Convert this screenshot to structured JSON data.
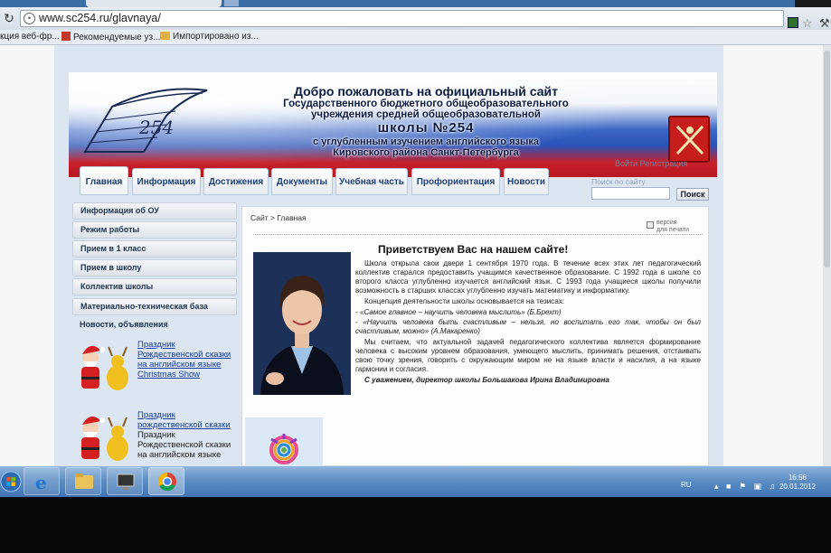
{
  "browser": {
    "url": "www.sc254.ru/glavnaya/",
    "bookmarks": [
      {
        "label": "кция веб-фр..."
      },
      {
        "label": "Рекомендуемые уз..."
      },
      {
        "label": "Импортировано из..."
      }
    ]
  },
  "banner": {
    "line1": "Добро пожаловать на официальный сайт",
    "line2": "Государственного бюджетного общеобразовательного",
    "line3": "учреждения средней общеобразовательной",
    "line4": "школы №254",
    "line5": "с углубленным изучением английского языка",
    "line6": "Кировского района Санкт-Петербурга",
    "logo_text": "254",
    "login_links": "Войти   Регистрация"
  },
  "nav": {
    "tabs": [
      {
        "label": "Главная"
      },
      {
        "label": "Информация"
      },
      {
        "label": "Достижения"
      },
      {
        "label": "Документы"
      },
      {
        "label": "Учебная часть"
      },
      {
        "label": "Профориентация"
      },
      {
        "label": "Новости"
      }
    ]
  },
  "search": {
    "label": "Поиск по сайту",
    "value": "",
    "button": "Поиск"
  },
  "sidebar": {
    "items": [
      {
        "label": "Информация об ОУ"
      },
      {
        "label": "Режим работы"
      },
      {
        "label": "Прием в 1 класс"
      },
      {
        "label": "Прием в школу"
      },
      {
        "label": "Коллектив школы"
      },
      {
        "label": "Материально-техническая база"
      },
      {
        "label": "Новости, объявления"
      }
    ],
    "event1": {
      "line1": "Праздник",
      "line2": "Рождественской сказки",
      "line3": "на английском языке",
      "line4": "Christmas Show"
    },
    "event2": {
      "link1": "Праздник",
      "link2": "рождественской сказки",
      "line3": "Праздник",
      "line4": "Рождественской сказки",
      "line5": "на английском языке"
    }
  },
  "content": {
    "breadcrumb": "Сайт > Главная",
    "print_line1": "версия",
    "print_line2": "для печати",
    "title": "Приветствуем Вас на нашем сайте!",
    "p1": "Школа открыла свои двери 1 сентября 1970 года. В течение всех этих лет педагогический коллектив старался предоставить учащимся качественное образование. С 1992 года в школе со второго класса углубленно изучается английский язык. С 1993 года учащиеся школы получили возможность в старших классах углубленно изучать математику и информатику.",
    "p2": "Концепция деятельности школы основывается на тезисах:",
    "q1": "- «Самое главное – научить человека мыслить» (Б.Брехт)",
    "q2": "- «Научить человека быть счастливым – нельзя, но воспитать его так, чтобы он был счастливым, можно» (А.Макаренко)",
    "p3": "Мы считаем, что актуальной задачей педагогического коллектива является формирование человека с высоким уровнем образования, умеющего мыслить, принимать решения, отстаивать свою точку зрения, говорить с окружающим миром не на языке власти и насилия, а на языке гармонии и согласия.",
    "sign": "С уважением, директор школы Большакова Ирина Владимировна"
  },
  "taskbar": {
    "lang": "RU",
    "time": "16:56",
    "date": "20.01.2012"
  }
}
